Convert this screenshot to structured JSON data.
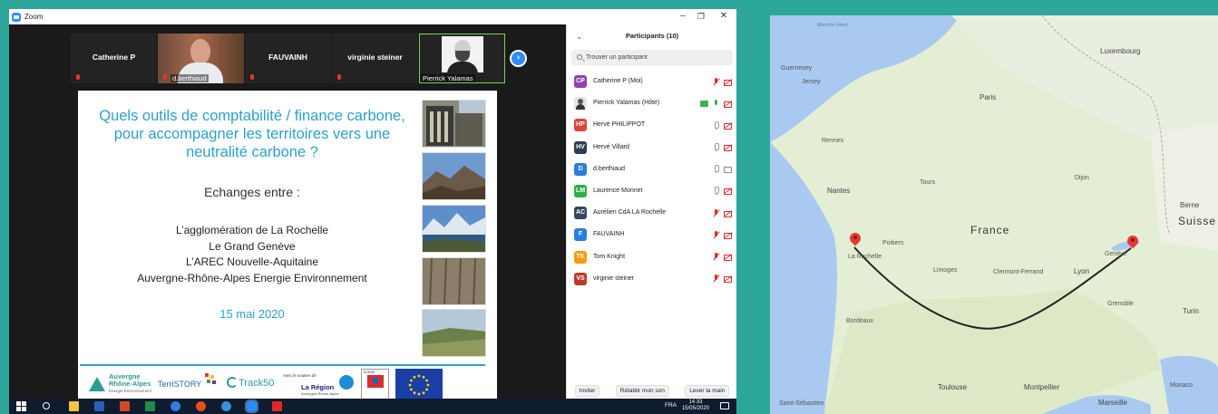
{
  "window": {
    "app_title": "Zoom"
  },
  "thumbnails": [
    {
      "name": "Catherine P",
      "muted": true
    },
    {
      "name": "d.berthiaud",
      "muted": true,
      "video": true
    },
    {
      "name": "FAUVAINH",
      "muted": true
    },
    {
      "name": "virginie steiner",
      "muted": true
    },
    {
      "name": "Pierrick Yalamas",
      "video": true,
      "active": true
    }
  ],
  "slide": {
    "title": "Quels outils de comptabilité / finance carbone, pour accompagner les territoires vers une neutralité carbone ?",
    "subtitle": "Echanges entre :",
    "parties": [
      "L’agglomération de La Rochelle",
      "Le Grand Genève",
      "L’AREC Nouvelle-Aquitaine",
      "Auvergne-Rhône-Alpes Energie Environnement"
    ],
    "date": "15 mai 2020",
    "logos": {
      "auvergne_line1": "Auvergne",
      "auvergne_line2": "Rhône-Alpes",
      "auvergne_sub": "Énergie Environnement",
      "territory": "TerriSTORY",
      "track": "Track50",
      "support": "Avec le soutien de :",
      "region": "La Région",
      "region_sub": "Auvergne-Rhône-Alpes",
      "ademe": "ADEME"
    }
  },
  "participants": {
    "title": "Participants (10)",
    "search_placeholder": "Trouver un participant",
    "list": [
      {
        "initials": "CP",
        "name": "Catherine P (Moi)",
        "color": "#8e44ad",
        "mic": "off",
        "cam": "off"
      },
      {
        "initials": "",
        "name": "Pierrick Yalamas (Hôte)",
        "color": "#e6e6e6",
        "photo": true,
        "share": true,
        "mic": "green",
        "cam": "off"
      },
      {
        "initials": "HP",
        "name": "Hervé PHILIPPOT",
        "color": "#d9453b",
        "mic": "on",
        "cam": "off"
      },
      {
        "initials": "HV",
        "name": "Hervé Villard",
        "color": "#2c3e50",
        "mic": "on",
        "cam": "off"
      },
      {
        "initials": "D",
        "name": "d.berthiaud",
        "color": "#2a7de1",
        "mic": "on",
        "cam": "on"
      },
      {
        "initials": "LM",
        "name": "Laurence Monnet",
        "color": "#2fae4a",
        "mic": "on",
        "cam": "off"
      },
      {
        "initials": "AC",
        "name": "Aurélien CdA LA Rochelle",
        "color": "#34495e",
        "mic": "off",
        "cam": "off"
      },
      {
        "initials": "F",
        "name": "FAUVAINH",
        "color": "#2a7de1",
        "mic": "off",
        "cam": "off"
      },
      {
        "initials": "TK",
        "name": "Tom Knight",
        "color": "#f39c12",
        "mic": "off",
        "cam": "off"
      },
      {
        "initials": "VS",
        "name": "virginie steiner",
        "color": "#c0392b",
        "mic": "off",
        "cam": "off"
      }
    ],
    "buttons": {
      "invite": "Inviter",
      "unmute": "Rétablir mon son",
      "raise_hand": "Lever la main"
    }
  },
  "taskbar": {
    "lang": "FRA",
    "time": "14:33",
    "date": "15/05/2020"
  },
  "map": {
    "country": "France",
    "route_from": "La Rochelle",
    "route_to": "Genève",
    "labels": {
      "manche": "Manche (mer)",
      "guernsey": "Guernesey",
      "jersey": "Jersey",
      "luxembourg": "Luxembourg",
      "paris": "Paris",
      "rennes": "Rennes",
      "nantes": "Nantes",
      "tours": "Tours",
      "dijon": "Dijon",
      "berne": "Berne",
      "suisse": "Suisse",
      "poitiers": "Poitiers",
      "limoges": "Limoges",
      "clermont": "Clermont-Ferrand",
      "lyon": "Lyon",
      "bordeaux": "Bordeaux",
      "grenoble": "Grenoble",
      "turin": "Turin",
      "toulouse": "Toulouse",
      "montpellier": "Montpellier",
      "marseille": "Marseille",
      "monaco": "Monaco",
      "saint_sebastien": "Saint-Sébastien"
    }
  }
}
